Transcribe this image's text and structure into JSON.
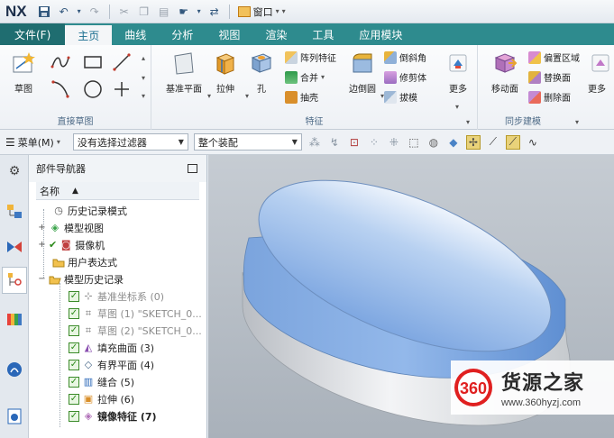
{
  "titlebar": {
    "logo": "NX",
    "window_label": "窗口"
  },
  "tabs": [
    {
      "label": "文件(F)"
    },
    {
      "label": "主页"
    },
    {
      "label": "曲线"
    },
    {
      "label": "分析"
    },
    {
      "label": "视图"
    },
    {
      "label": "渲染"
    },
    {
      "label": "工具"
    },
    {
      "label": "应用模块"
    }
  ],
  "ribbon": {
    "direct_sketch": {
      "group_label": "直接草图",
      "sketch_label": "草图"
    },
    "feature": {
      "group_label": "特征",
      "datum_plane": "基准平面",
      "extrude": "拉伸",
      "hole": "孔",
      "pattern_feature": "阵列特征",
      "unite": "合并",
      "shell": "抽壳",
      "edge_blend": "边倒圆",
      "chamfer": "倒斜角",
      "trim_body": "修剪体",
      "draft": "拔模",
      "more": "更多"
    },
    "sync_modeling": {
      "group_label": "同步建模",
      "move_face": "移动面",
      "offset_region": "偏置区域",
      "replace_face": "替换面",
      "delete_face": "删除面",
      "more_cut": "更多"
    }
  },
  "cmdbar": {
    "menu_label": "菜单(M)",
    "filter_combo": "没有选择过滤器",
    "assembly_combo": "整个装配"
  },
  "navigator": {
    "title": "部件导航器",
    "column_name": "名称",
    "nodes": [
      {
        "label": "历史记录模式"
      },
      {
        "label": "模型视图"
      },
      {
        "label": "摄像机"
      },
      {
        "label": "用户表达式"
      },
      {
        "label": "模型历史记录"
      },
      {
        "label": "基准坐标系 (0)"
      },
      {
        "label": "草图 (1) \"SKETCH_0..."
      },
      {
        "label": "草图 (2) \"SKETCH_0..."
      },
      {
        "label": "填充曲面 (3)"
      },
      {
        "label": "有界平面 (4)"
      },
      {
        "label": "缝合 (5)"
      },
      {
        "label": "拉伸 (6)"
      },
      {
        "label": "镜像特征 (7)"
      }
    ]
  },
  "watermark": {
    "logo_text": "360",
    "name": "货源之家",
    "url": "www.360hyzj.com"
  },
  "colors": {
    "tab_bar": "#2e8b8e",
    "active_tab_text": "#1a6e8f",
    "model_top": "#8fb6ea",
    "model_side": "#e6e8eb",
    "viewport_bg": "#b8bfc7",
    "watermark_red": "#e02020"
  }
}
